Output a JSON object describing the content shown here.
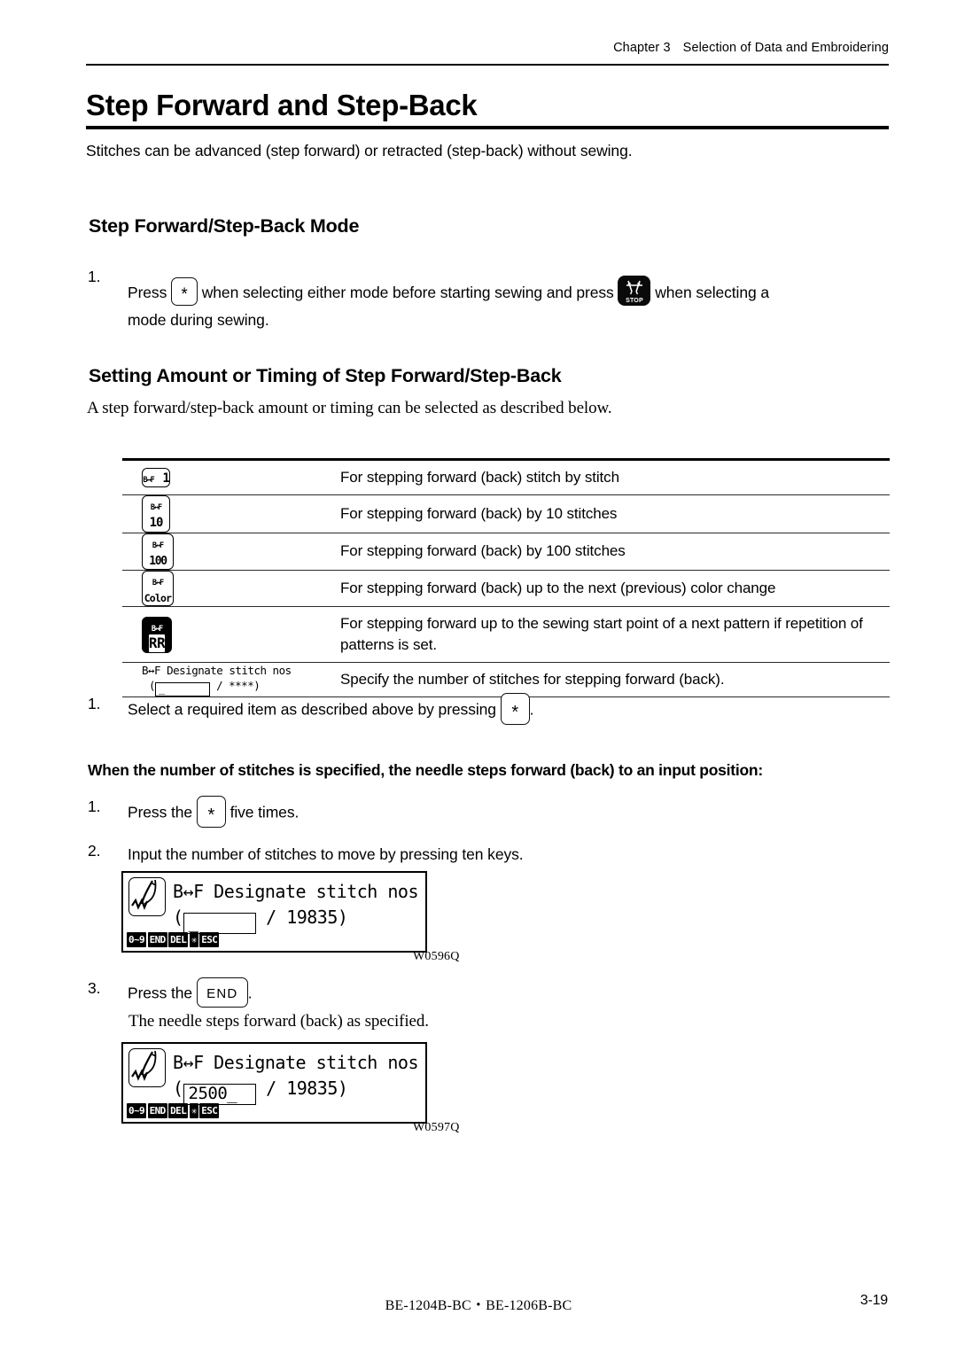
{
  "header": {
    "chapter": "Chapter 3",
    "section": "Selection of Data and Embroidering"
  },
  "title": "Step Forward and Step-Back",
  "intro": "Stitches can be advanced (step forward) or retracted (step-back) without sewing.",
  "section_mode": {
    "heading": "Step Forward/Step-Back Mode",
    "step_number": "1.",
    "text_before_key": "Press",
    "key_star": "*",
    "text_middle": "when selecting either mode before starting sewing and press",
    "stop_key_label": "STOP",
    "text_after": "when selecting a",
    "text_line2": "mode during sewing."
  },
  "section_setting": {
    "heading": "Setting Amount or Timing of Step Forward/Step-Back",
    "lead": "A step forward/step-back amount or timing can be selected as described below."
  },
  "options_table": {
    "rows": [
      {
        "icon_type": "bf-key",
        "icon_top": "B↔F",
        "icon_value": "1",
        "description": "For stepping forward (back) stitch by stitch"
      },
      {
        "icon_type": "bf-key",
        "icon_top": "B↔F",
        "icon_value": "10",
        "description": "For stepping forward (back) by 10 stitches"
      },
      {
        "icon_type": "bf-key",
        "icon_top": "B↔F",
        "icon_value": "100",
        "description": "For stepping forward (back) by 100 stitches"
      },
      {
        "icon_type": "bf-key",
        "icon_top": "B↔F",
        "icon_value": "Color",
        "description": "For stepping forward (back) up to the next (previous) color change"
      },
      {
        "icon_type": "bf-key-inverted",
        "icon_top": "B↔F",
        "icon_value": "RR",
        "description": "For stepping forward up to the sewing start point of a next pattern if repetition of patterns is set."
      },
      {
        "icon_type": "mini-lcd",
        "lcd_line1": "B↔F Designate stitch nos",
        "lcd_paren_open": "(",
        "lcd_field_value": "_",
        "lcd_separator": "/",
        "lcd_total": "****)",
        "description": "Specify the number of stitches for stepping forward (back)."
      }
    ]
  },
  "step_select": {
    "number": "1.",
    "text_before_key": "Select a required item as described above by pressing",
    "key_star": "*",
    "text_after": "."
  },
  "bold_note": "When the number of stitches is specified, the needle steps forward (back) to an input position:",
  "step_press_five": {
    "number": "1.",
    "text_before_key": "Press the",
    "key_star": "*",
    "text_after": "five times."
  },
  "step_input": {
    "number": "2.",
    "text": "Input the number of stitches to move by pressing ten keys."
  },
  "lcd_panel_1": {
    "needle_icon": "needle-stitch-icon",
    "line1": "B↔F Designate stitch nos",
    "paren_open": "(",
    "field_value": "_",
    "separator": "/",
    "total": "19835)",
    "softkeys": [
      "0~9",
      "END",
      "DEL",
      "✳",
      "ESC"
    ],
    "figure_label": "W0596Q"
  },
  "step_press_end": {
    "number": "3.",
    "text_before_key": "Press the",
    "key_end": "END",
    "text_after": ".",
    "result_text": "The needle steps forward (back) as specified."
  },
  "lcd_panel_2": {
    "needle_icon": "needle-stitch-icon",
    "line1": "B↔F Designate stitch nos",
    "paren_open": "(",
    "field_value": "2500_",
    "separator": "/",
    "total": "19835)",
    "softkeys": [
      "0~9",
      "END",
      "DEL",
      "✳",
      "ESC"
    ],
    "figure_label": "W0597Q"
  },
  "footer": {
    "models": "BE-1204B-BC・BE-1206B-BC",
    "page_number": "3-19"
  }
}
